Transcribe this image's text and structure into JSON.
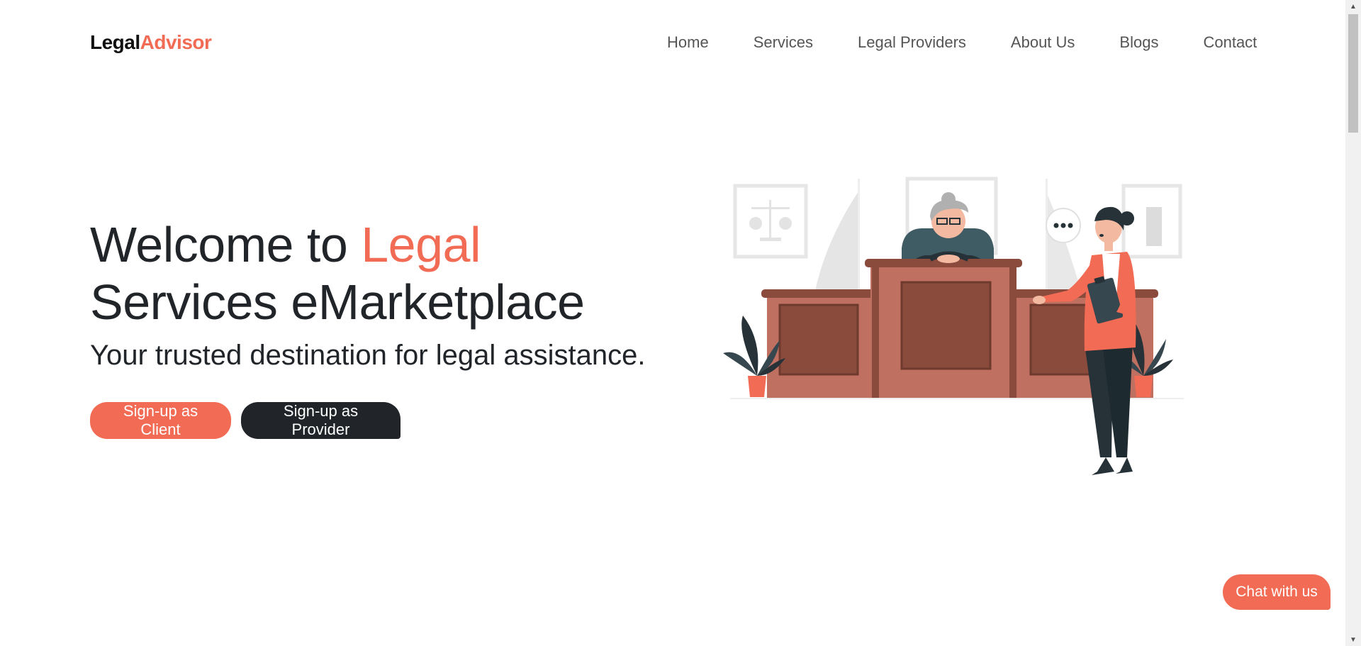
{
  "brand": {
    "part1": "Legal",
    "part2": "Advisor"
  },
  "nav": {
    "items": [
      {
        "label": "Home"
      },
      {
        "label": "Services"
      },
      {
        "label": "Legal Providers"
      },
      {
        "label": "About Us"
      },
      {
        "label": "Blogs"
      },
      {
        "label": "Contact"
      }
    ]
  },
  "hero": {
    "title_prefix": "Welcome to ",
    "title_accent": "Legal",
    "title_rest": "Services eMarketplace",
    "subtitle": "Your trusted destination for legal assistance.",
    "client_button": "Sign-up as Client",
    "provider_button": "Sign-up as Provider"
  },
  "chat": {
    "label": "Chat with us"
  },
  "colors": {
    "accent": "#f26b54",
    "dark": "#212529",
    "desk": "#c07060",
    "deskDark": "#8a4b3d"
  },
  "icons": {
    "scroll_up": "triangle-up-icon",
    "scroll_down": "triangle-down-icon"
  }
}
